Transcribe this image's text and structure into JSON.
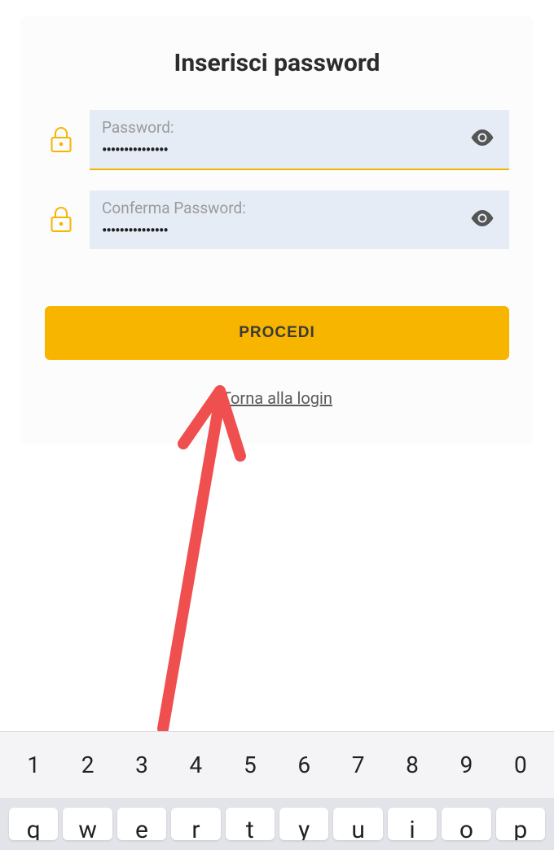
{
  "card": {
    "title": "Inserisci password",
    "password": {
      "label": "Password:",
      "value": "•••••••••••••••"
    },
    "confirm": {
      "label": "Conferma Password:",
      "value": "•••••••••••••••"
    },
    "proceed_button": "PROCEDI",
    "back_link": "Torna alla login"
  },
  "keyboard": {
    "numbers": [
      "1",
      "2",
      "3",
      "4",
      "5",
      "6",
      "7",
      "8",
      "9",
      "0"
    ],
    "letters": [
      "q",
      "w",
      "e",
      "r",
      "t",
      "y",
      "u",
      "i",
      "o",
      "p"
    ]
  }
}
